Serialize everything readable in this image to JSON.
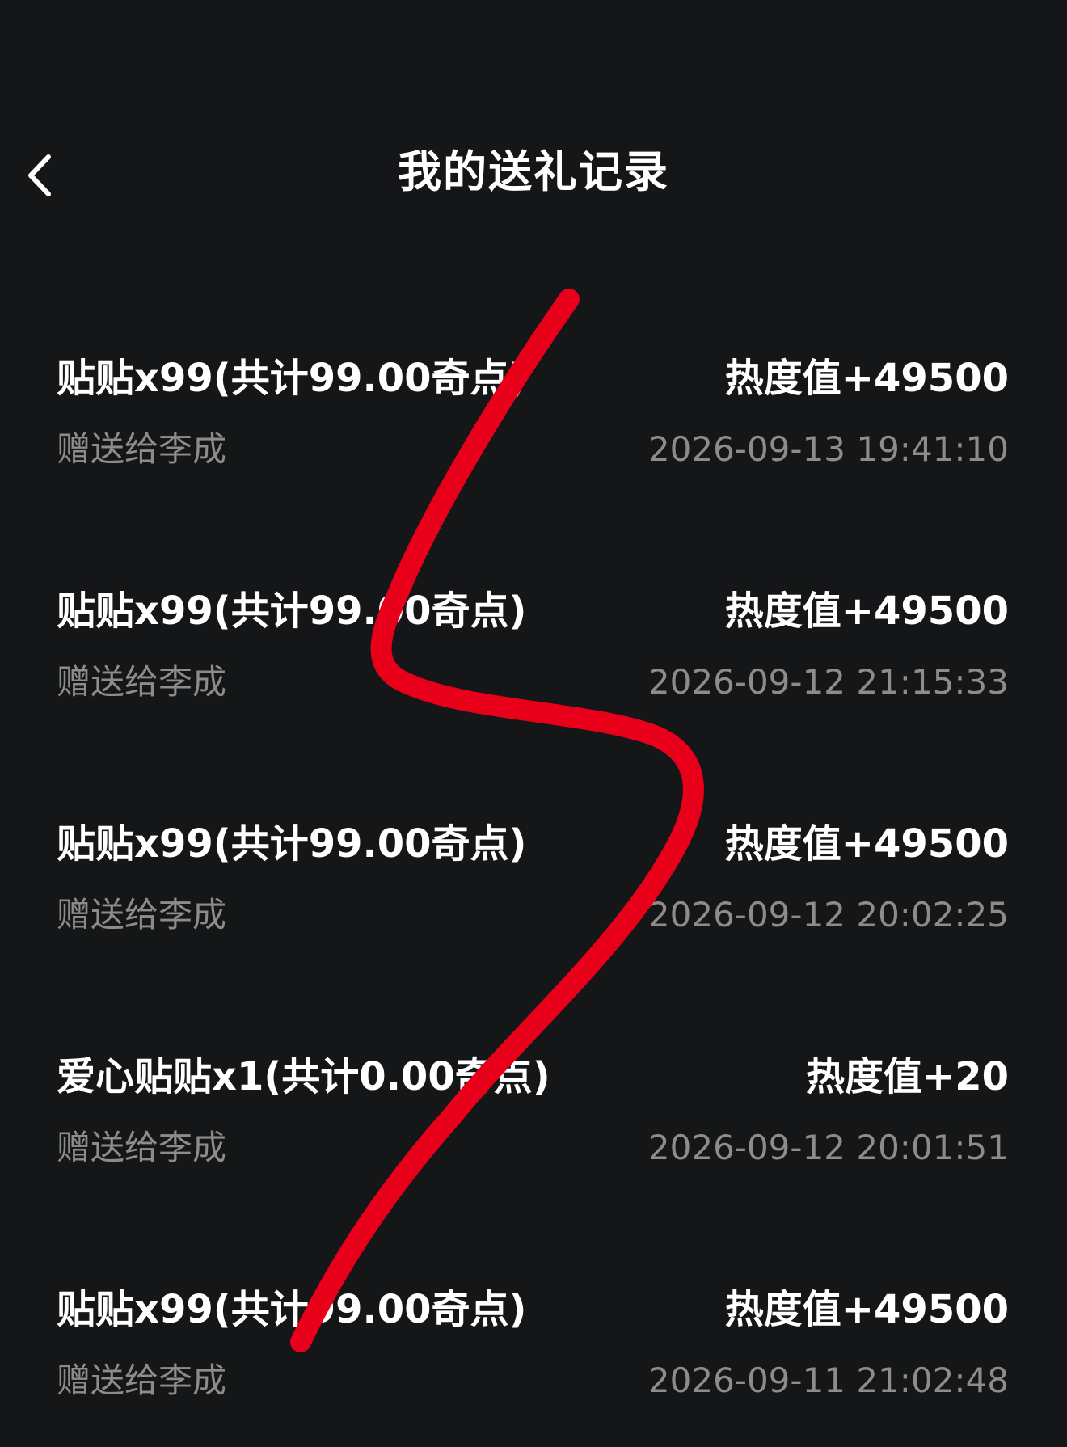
{
  "header": {
    "title": "我的送礼记录",
    "back_icon": "chevron-left-icon"
  },
  "records": [
    {
      "gift": "贴贴x99(共计99.00奇点)",
      "heat": "热度值+49500",
      "recipient": "赠送给李成",
      "time": "2026-09-13 19:41:10"
    },
    {
      "gift": "贴贴x99(共计99.00奇点)",
      "heat": "热度值+49500",
      "recipient": "赠送给李成",
      "time": "2026-09-12 21:15:33"
    },
    {
      "gift": "贴贴x99(共计99.00奇点)",
      "heat": "热度值+49500",
      "recipient": "赠送给李成",
      "time": "2026-09-12 20:02:25"
    },
    {
      "gift": "爱心贴贴x1(共计0.00奇点)",
      "heat": "热度值+20",
      "recipient": "赠送给李成",
      "time": "2026-09-12 20:01:51"
    },
    {
      "gift": "贴贴x99(共计99.00奇点)",
      "heat": "热度值+49500",
      "recipient": "赠送给李成",
      "time": "2026-09-11 21:02:48"
    }
  ],
  "colors": {
    "background": "#141618",
    "primary_text": "#ffffff",
    "secondary_text": "#8c8c8c",
    "scribble": "#e8001a"
  }
}
